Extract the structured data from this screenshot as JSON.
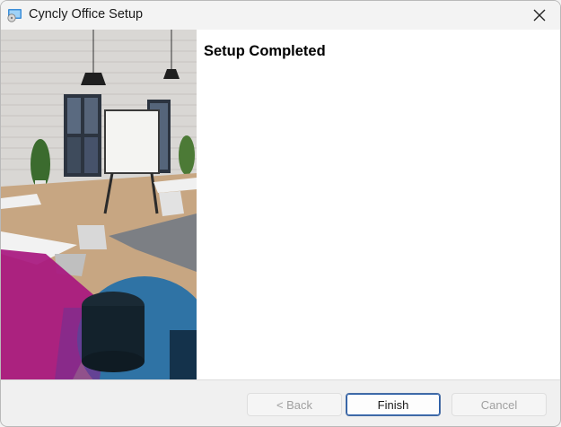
{
  "window": {
    "title": "Cyncly Office Setup"
  },
  "main": {
    "heading": "Setup Completed"
  },
  "buttons": {
    "back": "< Back",
    "finish": "Finish",
    "cancel": "Cancel"
  },
  "icons": {
    "app": "setup-installer-icon",
    "close": "close-icon"
  }
}
